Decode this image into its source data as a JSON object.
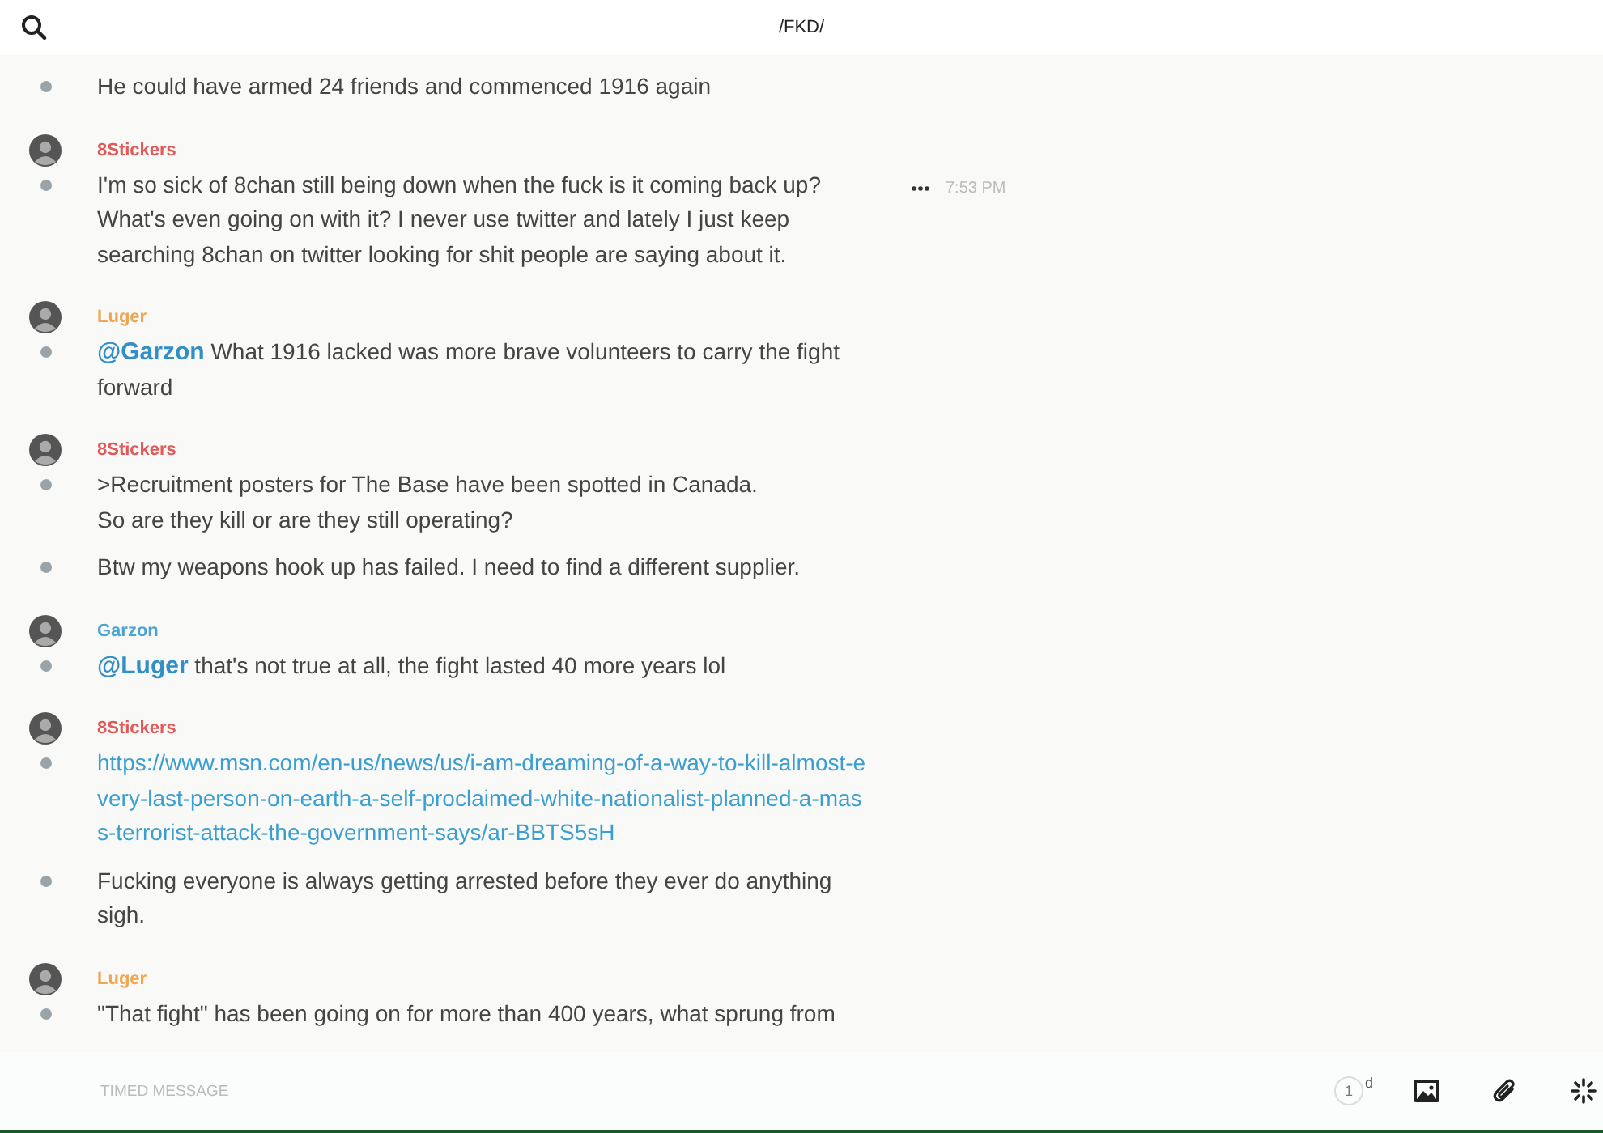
{
  "header": {
    "title": "/FKD/"
  },
  "groups": [
    {
      "messages": [
        {
          "kind": "text",
          "text": "He could have armed 24 friends and commenced 1916 again"
        }
      ]
    },
    {
      "author": "8Stickers",
      "color": "#e05a5a",
      "messages": [
        {
          "kind": "text",
          "text": "I'm so sick of 8chan still being down when the fuck is it coming back up? What's even going on with it? I never use twitter and lately I just keep searching 8chan on twitter looking for shit people are saying about it.",
          "time": "7:53 PM"
        }
      ]
    },
    {
      "author": "Luger",
      "color": "#efa552",
      "messages": [
        {
          "kind": "text",
          "mention": "@Garzon",
          "text": "What 1916 lacked was more brave volunteers to carry the fight forward"
        }
      ]
    },
    {
      "author": "8Stickers",
      "color": "#e05a5a",
      "messages": [
        {
          "kind": "text",
          "text": ">Recruitment posters for The Base have been spotted in Canada.\nSo are they kill or are they still operating?"
        },
        {
          "kind": "text",
          "text": "Btw my weapons hook up has failed. I need to find a different supplier."
        }
      ]
    },
    {
      "author": "Garzon",
      "color": "#4aa3d0",
      "messages": [
        {
          "kind": "text",
          "mention": "@Luger",
          "text": "that's not true at all, the fight lasted 40 more years lol"
        }
      ]
    },
    {
      "author": "8Stickers",
      "color": "#e05a5a",
      "messages": [
        {
          "kind": "link",
          "text": "https://www.msn.com/en-us/news/us/i-am-dreaming-of-a-way-to-kill-almost-every-last-person-on-earth-a-self-proclaimed-white-nationalist-planned-a-mass-terrorist-attack-the-government-says/ar-BBTS5sH"
        },
        {
          "kind": "text",
          "text": "Fucking everyone is always getting arrested before they ever do anything sigh."
        }
      ]
    },
    {
      "author": "Luger",
      "color": "#efa552",
      "messages": [
        {
          "kind": "text",
          "text": "\"That fight\" has been going on for more than 400 years, what sprung from"
        }
      ]
    }
  ],
  "composer": {
    "placeholder": "TIMED MESSAGE",
    "timer": "1",
    "timer_unit": "d"
  }
}
